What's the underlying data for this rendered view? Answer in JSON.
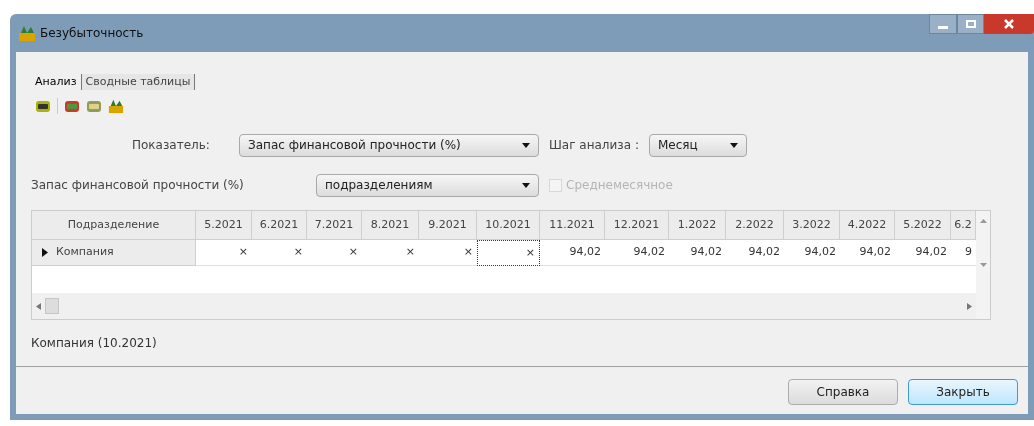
{
  "window": {
    "title": "Безубыточность"
  },
  "tabs": [
    {
      "label": "Анализ",
      "selected": true
    },
    {
      "label": "Сводные таблицы",
      "selected": false
    }
  ],
  "indicator": {
    "label": "Показатель:",
    "value": "Запас финансовой прочности (%)"
  },
  "step": {
    "label": "Шаг анализа :",
    "value": "Месяц"
  },
  "breakdown": {
    "label": "Запас финансовой прочности (%)",
    "value": "подразделениям"
  },
  "monthly_average": {
    "label": "Среднемесячное",
    "checked": false,
    "disabled": true
  },
  "table": {
    "columns": [
      "Подразделение",
      "5.2021",
      "6.2021",
      "7.2021",
      "8.2021",
      "9.2021",
      "10.2021",
      "11.2021",
      "12.2021",
      "1.2022",
      "2.2022",
      "3.2022",
      "4.2022",
      "5.2022",
      "6.2"
    ],
    "rows": [
      {
        "selected": true,
        "cells": [
          {
            "text": "Компания",
            "selected": false
          },
          {
            "text": "×",
            "selected": false
          },
          {
            "text": "×",
            "selected": false
          },
          {
            "text": "×",
            "selected": false
          },
          {
            "text": "×",
            "selected": false
          },
          {
            "text": "×",
            "selected": false
          },
          {
            "text": "×",
            "selected": true
          },
          {
            "text": "94,02",
            "selected": false
          },
          {
            "text": "94,02",
            "selected": false
          },
          {
            "text": "94,02",
            "selected": false
          },
          {
            "text": "94,02",
            "selected": false
          },
          {
            "text": "94,02",
            "selected": false
          },
          {
            "text": "94,02",
            "selected": false
          },
          {
            "text": "94,02",
            "selected": false
          },
          {
            "text": "9",
            "selected": false
          }
        ]
      }
    ]
  },
  "status": "Компания (10.2021)",
  "buttons": [
    {
      "label": "Справка",
      "default": false
    },
    {
      "label": "Закрыть",
      "default": true
    }
  ]
}
